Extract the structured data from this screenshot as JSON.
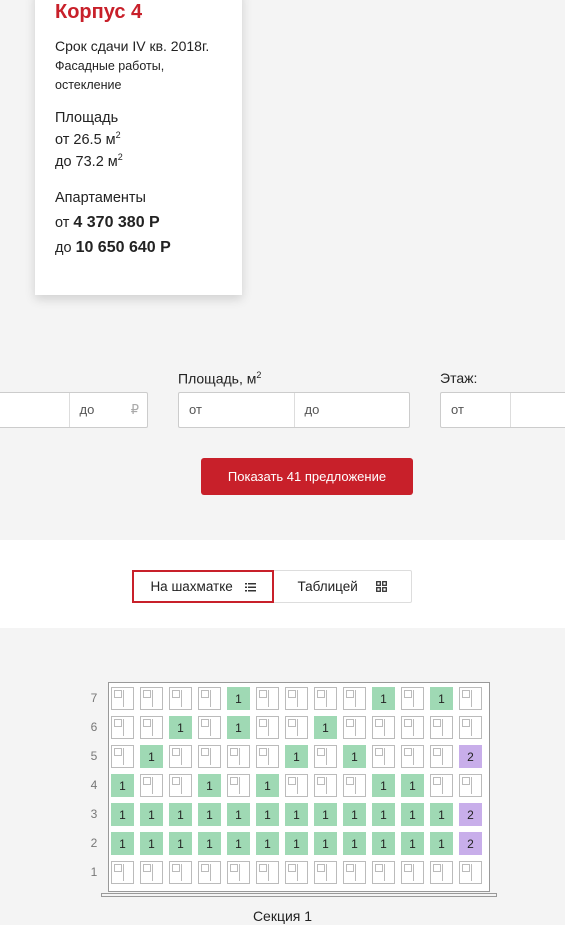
{
  "card": {
    "title": "Корпус 4",
    "deadline": "Срок сдачи IV кв. 2018г.",
    "works": "Фасадные работы,",
    "works2": "остекление",
    "area_label": "Площадь",
    "area_from": "от 26.5 м",
    "area_to": "до 73.2 м",
    "area_sup": "2",
    "apartments_label": "Апартаменты",
    "price_from_prefix": "от",
    "price_from": "4 370 380 Р",
    "price_to_prefix": "до",
    "price_to": "10 650 640 Р"
  },
  "filters": {
    "price": {
      "to_placeholder": "до",
      "currency": "₽"
    },
    "area": {
      "label": "Площадь, м",
      "label_sup": "2",
      "from": "от",
      "to": "до"
    },
    "floor": {
      "label": "Этаж:",
      "from": "от"
    }
  },
  "show_button": "Показать 41 предложение",
  "view_toggle": {
    "chess": "На шахматке",
    "table": "Таблицей",
    "active": "chess"
  },
  "board": {
    "floors": [
      "7",
      "6",
      "5",
      "4",
      "3",
      "2",
      "1"
    ],
    "section_label": "Секция 1",
    "colors": {
      "available": "#9fd9b4",
      "reserved": "#c8aeea"
    },
    "grid": [
      [
        "",
        "",
        "",
        "",
        "1",
        "",
        "",
        "",
        "",
        "1",
        "",
        "1",
        ""
      ],
      [
        "",
        "",
        "1",
        "",
        "1",
        "",
        "",
        "1",
        "",
        "",
        "",
        "",
        ""
      ],
      [
        "",
        "1",
        "",
        "",
        "",
        "",
        "1",
        "",
        "1",
        "",
        "",
        "",
        "2"
      ],
      [
        "1",
        "",
        "",
        "1",
        "",
        "1",
        "",
        "",
        "",
        "1",
        "1",
        "",
        ""
      ],
      [
        "1",
        "1",
        "1",
        "1",
        "1",
        "1",
        "1",
        "1",
        "1",
        "1",
        "1",
        "1",
        "2"
      ],
      [
        "1",
        "1",
        "1",
        "1",
        "1",
        "1",
        "1",
        "1",
        "1",
        "1",
        "1",
        "1",
        "2"
      ],
      [
        "",
        "",
        "",
        "",
        "",
        "",
        "",
        "",
        "",
        "",
        "",
        "",
        ""
      ]
    ]
  }
}
